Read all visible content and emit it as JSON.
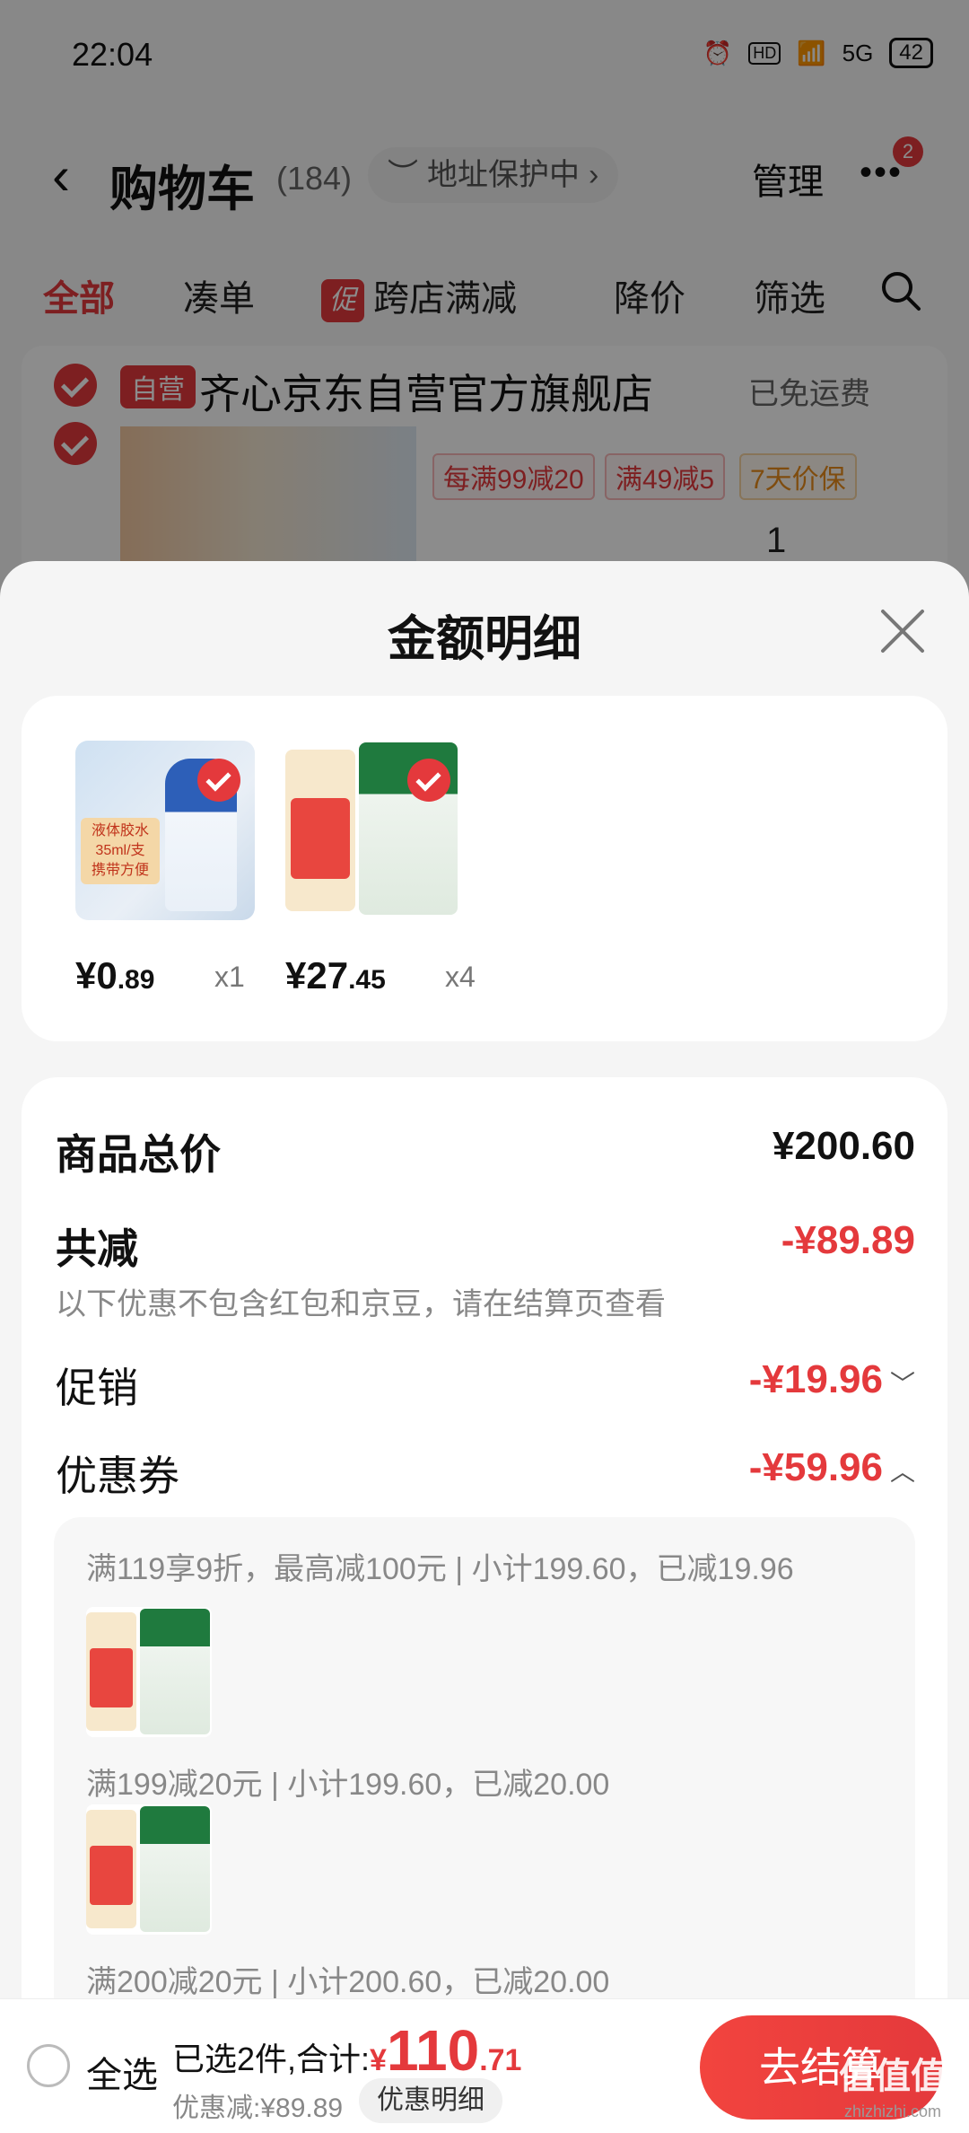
{
  "status_bar": {
    "time": "22:04",
    "network": "5G",
    "battery": "42"
  },
  "nav": {
    "title": "购物车",
    "count": "(184)",
    "address_protect": "地址保护中",
    "manage": "管理",
    "badge": "2"
  },
  "tabs": [
    "全部",
    "凑单",
    "跨店满减",
    "降价",
    "筛选"
  ],
  "tab_promo_icon": "促",
  "store": {
    "self_tag": "自营",
    "name": "齐心京东自营官方旗舰店",
    "free_shipping": "已免运费",
    "tags": [
      "每满99减20",
      "满49减5",
      "7天价保"
    ],
    "qty": "1"
  },
  "sheet": {
    "title": "金额明细",
    "items": [
      {
        "price_int": "¥0",
        "price_dec": ".89",
        "qty": "x1"
      },
      {
        "price_int": "¥27",
        "price_dec": ".45",
        "qty": "x4"
      }
    ],
    "total_label": "商品总价",
    "total_value": "¥200.60",
    "reduce_label": "共减",
    "reduce_value": "-¥89.89",
    "reduce_note": "以下优惠不包含红包和京豆，请在结算页查看",
    "promo_label": "促销",
    "promo_value": "-¥19.96",
    "coupon_label": "优惠券",
    "coupon_value": "-¥59.96",
    "coupon_rules": [
      "满119享9折，最高减100元 | 小计199.60，已减19.96",
      "满199减20元 | 小计199.60，已减20.00",
      "满200减20元 | 小计200.60，已减20.00"
    ]
  },
  "checkout": {
    "select_all": "全选",
    "selected_text": "已选2件,合计:",
    "currency": "¥",
    "total_int": "110",
    "total_dec": ".71",
    "discount": "优惠减:¥89.89",
    "detail_btn": "优惠明细",
    "checkout_btn": "去结算"
  },
  "watermark": {
    "logo": "值值值",
    "site": "zhizhizhi.com"
  },
  "colors": {
    "accent": "#e4393c",
    "background": "#f5f5f5"
  }
}
